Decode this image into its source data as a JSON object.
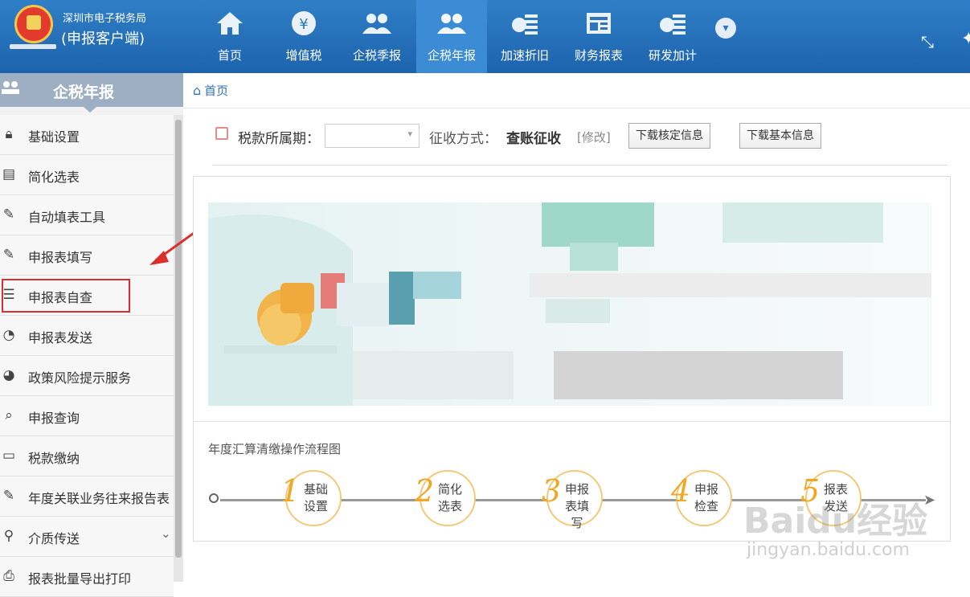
{
  "app": {
    "org_name": "深圳市电子税务局",
    "client_name": "(申报客户端)"
  },
  "nav": [
    {
      "label": "首页",
      "icon": "home-icon"
    },
    {
      "label": "增值税",
      "icon": "yuan-coin-icon"
    },
    {
      "label": "企税季报",
      "icon": "users-icon"
    },
    {
      "label": "企税年报",
      "icon": "users-icon"
    },
    {
      "label": "加速折旧",
      "icon": "coin-stack-icon"
    },
    {
      "label": "财务报表",
      "icon": "report-icon"
    },
    {
      "label": "研发加计",
      "icon": "coin-stack-icon"
    }
  ],
  "sidebar": {
    "title": "企税年报",
    "items": [
      {
        "label": "基础设置",
        "icon": "lock-icon"
      },
      {
        "label": "简化选表",
        "icon": "form-icon"
      },
      {
        "label": "自动填表工具",
        "icon": "edit-icon"
      },
      {
        "label": "申报表填写",
        "icon": "edit-icon"
      },
      {
        "label": "申报表自查",
        "icon": "checklist-icon"
      },
      {
        "label": "申报表发送",
        "icon": "send-icon"
      },
      {
        "label": "政策风险提示服务",
        "icon": "policy-icon"
      },
      {
        "label": "申报查询",
        "icon": "search-doc-icon"
      },
      {
        "label": "税款缴纳",
        "icon": "wallet-icon"
      },
      {
        "label": "年度关联业务往来报告表",
        "icon": "edit-icon"
      },
      {
        "label": "介质传送",
        "icon": "search-icon"
      },
      {
        "label": "报表批量导出打印",
        "icon": "print-icon"
      }
    ]
  },
  "breadcrumb": {
    "home": "首页"
  },
  "filter": {
    "period_label": "税款所属期：",
    "levy_label": "征收方式：",
    "levy_value": "查账征收",
    "modify_link": "[修改]",
    "download_verify_btn": "下载核定信息",
    "download_basic_btn": "下载基本信息"
  },
  "flow": {
    "title": "年度汇算清缴操作流程图",
    "steps": [
      {
        "num": "1",
        "label": "基础设置"
      },
      {
        "num": "2",
        "label": "简化选表"
      },
      {
        "num": "3",
        "label": "申报表填写"
      },
      {
        "num": "4",
        "label": "申报检查"
      },
      {
        "num": "5",
        "label": "报表发送"
      }
    ]
  },
  "watermark": {
    "text": "Baidu经验",
    "url": "jingyan.baidu.com"
  },
  "colors": {
    "topbar": "#1f68b3",
    "accent": "#2f74bd",
    "highlight_box": "#d9302d",
    "step_number": "#f0a724"
  }
}
